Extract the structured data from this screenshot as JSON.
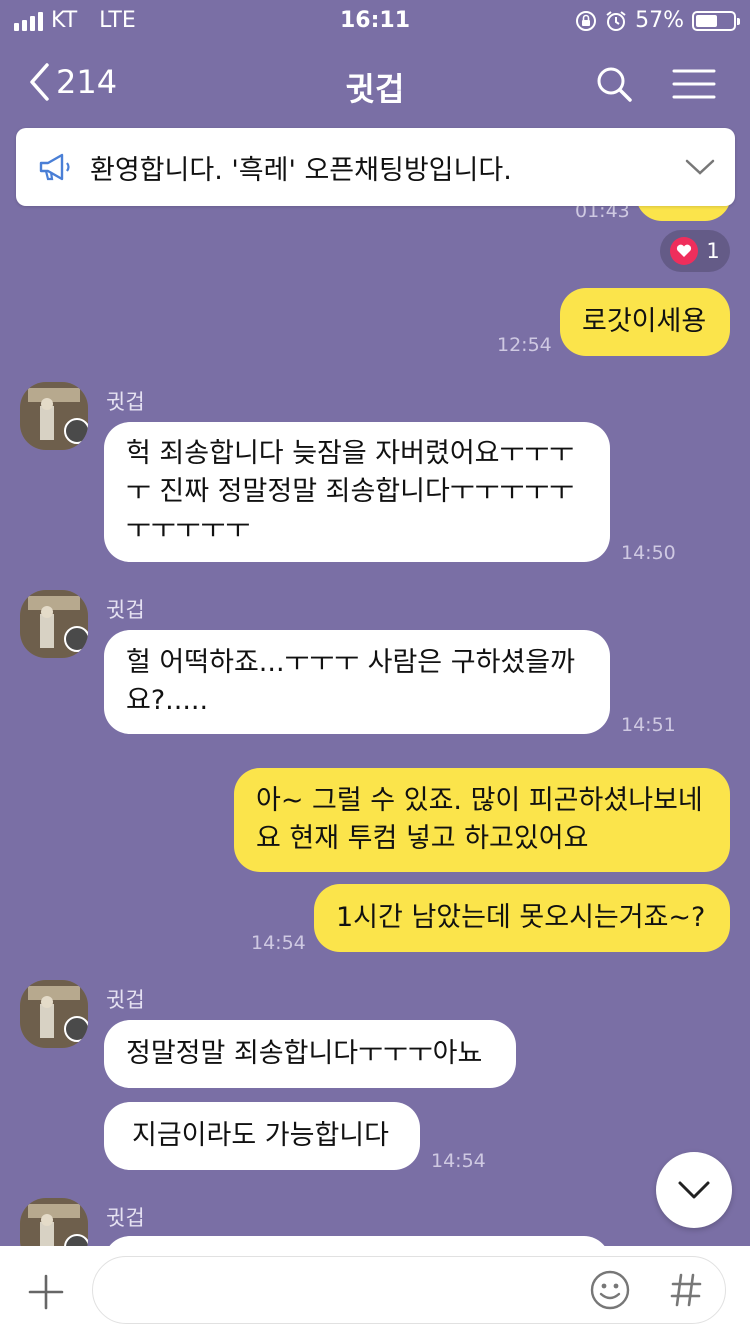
{
  "status": {
    "carrier": "KT",
    "network": "LTE",
    "time": "16:11",
    "battery": "57%",
    "battery_fraction": 0.57
  },
  "nav": {
    "back_count": "214",
    "title": "귓겁"
  },
  "notice": {
    "text": "환영합니다. '흑레' 오픈채팅방입니다."
  },
  "messages": {
    "partial_ts": "01:43",
    "heart_count": "1",
    "m1": {
      "text": "로갓이세용",
      "ts": "12:54"
    },
    "g1": {
      "sender": "귓겁",
      "text": "헉 죄송합니다 늦잠을 자버렸어요ㅜㅜㅜㅜ 진짜 정말정말 죄송합니다ㅜㅜㅜㅜㅜㅜㅜㅜㅜㅜ",
      "ts": "14:50"
    },
    "g2": {
      "sender": "귓겁",
      "text": "헐 어떡하죠...ㅜㅜㅜ 사람은 구하셨을까요?.....",
      "ts": "14:51"
    },
    "m2": {
      "text": "아~ 그럴 수 있죠. 많이 피곤하셨나보네요 현재 투컴 넣고 하고있어요"
    },
    "m3": {
      "text": "1시간 남았는데 못오시는거죠~?",
      "ts": "14:54"
    },
    "g3": {
      "sender": "귓겁",
      "text1": "정말정말 죄송합니다ㅜㅜㅜ아뇨",
      "text2": "지금이라도 가능합니다",
      "ts": "14:54"
    },
    "g4": {
      "sender": "귓겁"
    }
  },
  "input": {
    "placeholder": "",
    "value": ""
  },
  "colors": {
    "background": "#7a6fa5",
    "my_bubble": "#fbe44b",
    "their_bubble": "#ffffff",
    "heart": "#ef2e5c"
  }
}
